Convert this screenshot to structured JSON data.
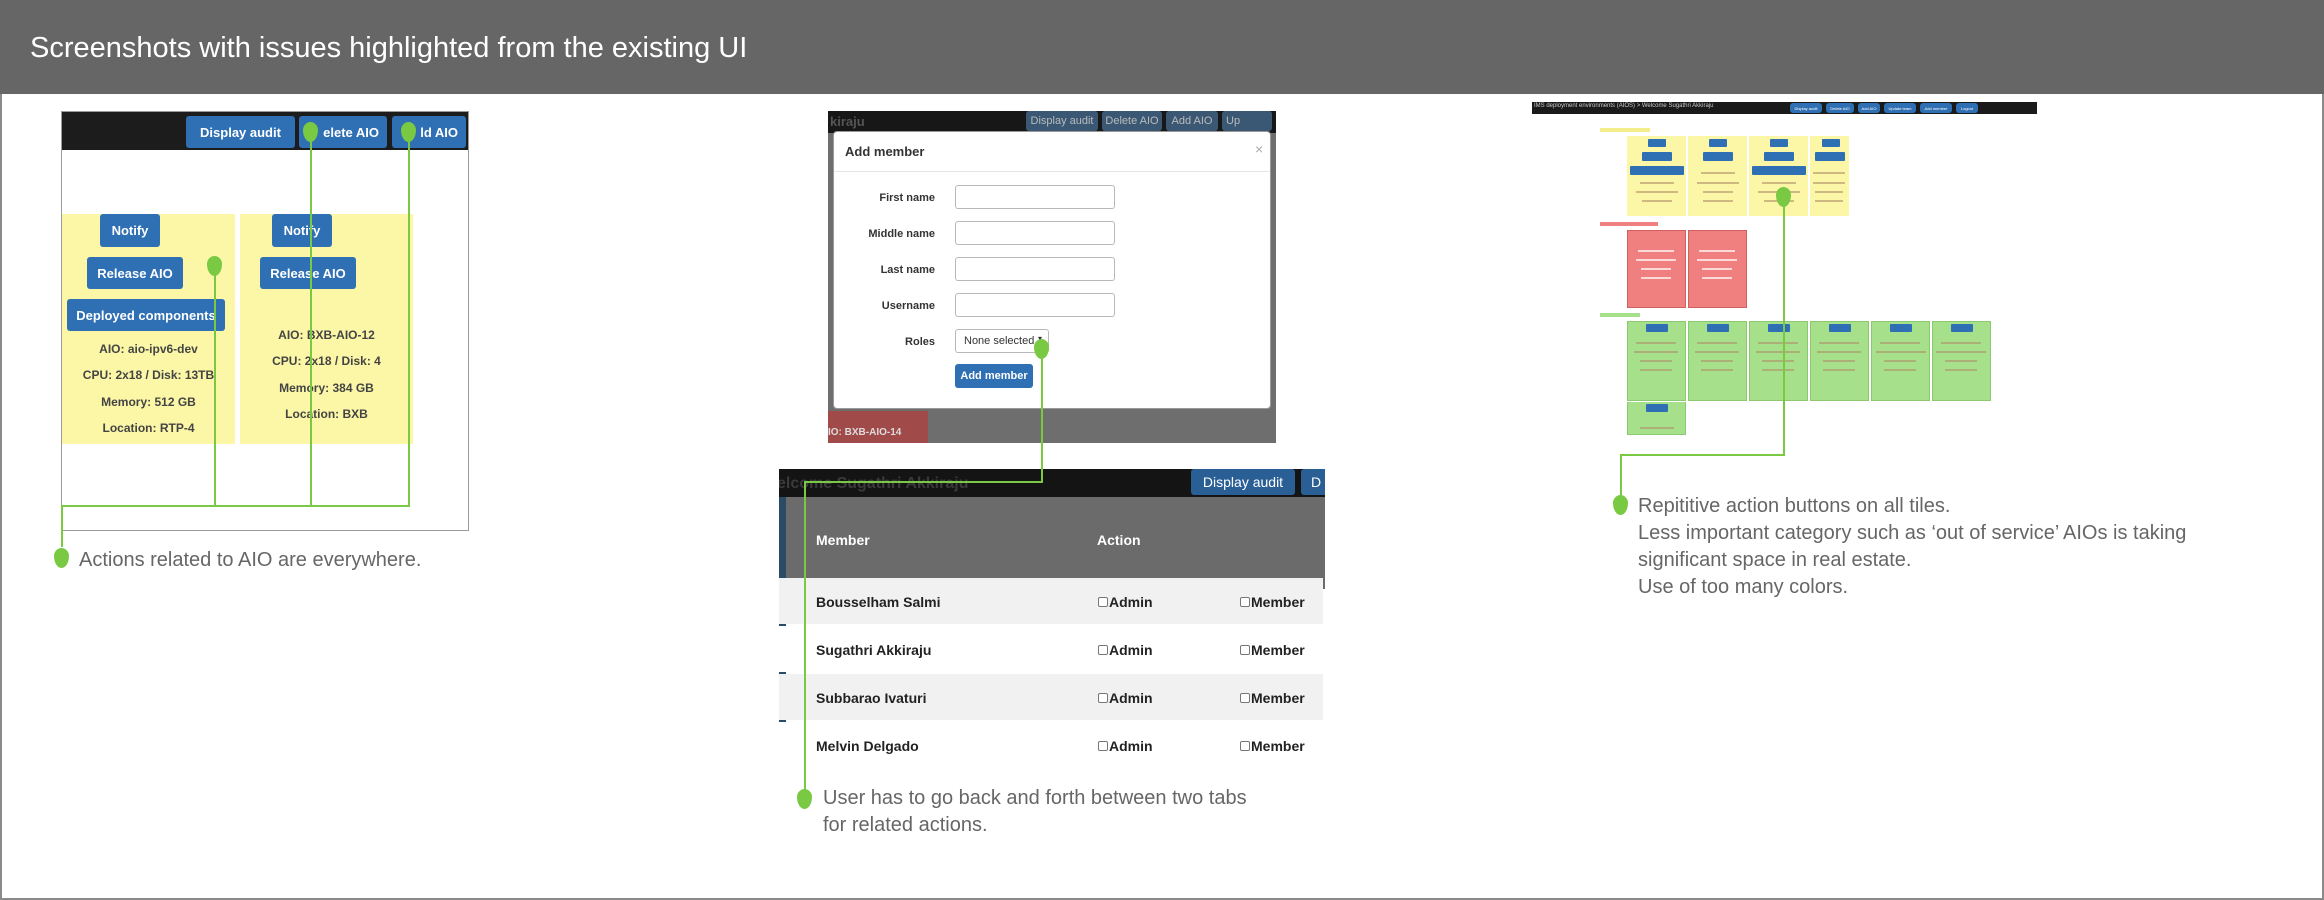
{
  "header": {
    "title": "Screenshots with issues highlighted from the existing UI"
  },
  "colors": {
    "header": "#666666",
    "accent_green": "#7ac943",
    "button_blue": "#2f6fb4",
    "tile_yellow": "#fbf7a6",
    "tile_red": "#f08080",
    "tile_green": "#a6e08a"
  },
  "shot1": {
    "topbar_buttons": [
      "Display audit",
      "elete AIO",
      "ld AIO"
    ],
    "tiles": [
      {
        "buttons": [
          "Notify",
          "Release AIO",
          "Deployed components"
        ],
        "info": [
          "AIO: aio-ipv6-dev",
          "CPU: 2x18 / Disk: 13TB",
          "Memory: 512 GB",
          "Location: RTP-4"
        ]
      },
      {
        "buttons": [
          "Notify",
          "Release AIO"
        ],
        "info": [
          "AIO: BXB-AIO-12",
          "CPU: 2x18 / Disk: 4",
          "Memory: 384 GB",
          "Location: BXB"
        ]
      }
    ],
    "note": "Actions related to AIO are everywhere."
  },
  "shot2": {
    "topbar_left": "kiraju",
    "topbar_buttons": [
      "Display audit",
      "Delete AIO",
      "Add AIO",
      "Up"
    ],
    "modal": {
      "title": "Add member",
      "close": "×",
      "fields": [
        "First name",
        "Middle name",
        "Last name",
        "Username"
      ],
      "roles_label": "Roles",
      "roles_value": "None selected",
      "submit": "Add member"
    },
    "bottom_tile_text": "IO: BXB-AIO-14"
  },
  "shot3": {
    "topbar_left": "elcome Sugathri Akkiraju",
    "topbar_buttons": [
      "Display audit",
      "D"
    ],
    "table": {
      "headers": [
        "Member",
        "Action"
      ],
      "check_labels": [
        "Admin",
        "Member"
      ],
      "rows": [
        "Bousselham Salmi",
        "Sugathri Akkiraju",
        "Subbarao Ivaturi",
        "Melvin Delgado"
      ]
    },
    "note_lines": [
      "User has to go back and forth between two tabs",
      "for related actions."
    ]
  },
  "shot4": {
    "topbar_left": "IMS deployment environments (AIOS) > Welcome Sugathri Akkiraju",
    "topbar_buttons": [
      "Display audit",
      "Delete AIO",
      "Add AIO",
      "Update team",
      "Add member",
      "Logout"
    ],
    "note_lines": [
      "Repititive action buttons on all tiles.",
      "Less important category such as ‘out of service’ AIOs is taking",
      "significant space in real estate.",
      "Use of too many colors."
    ]
  }
}
